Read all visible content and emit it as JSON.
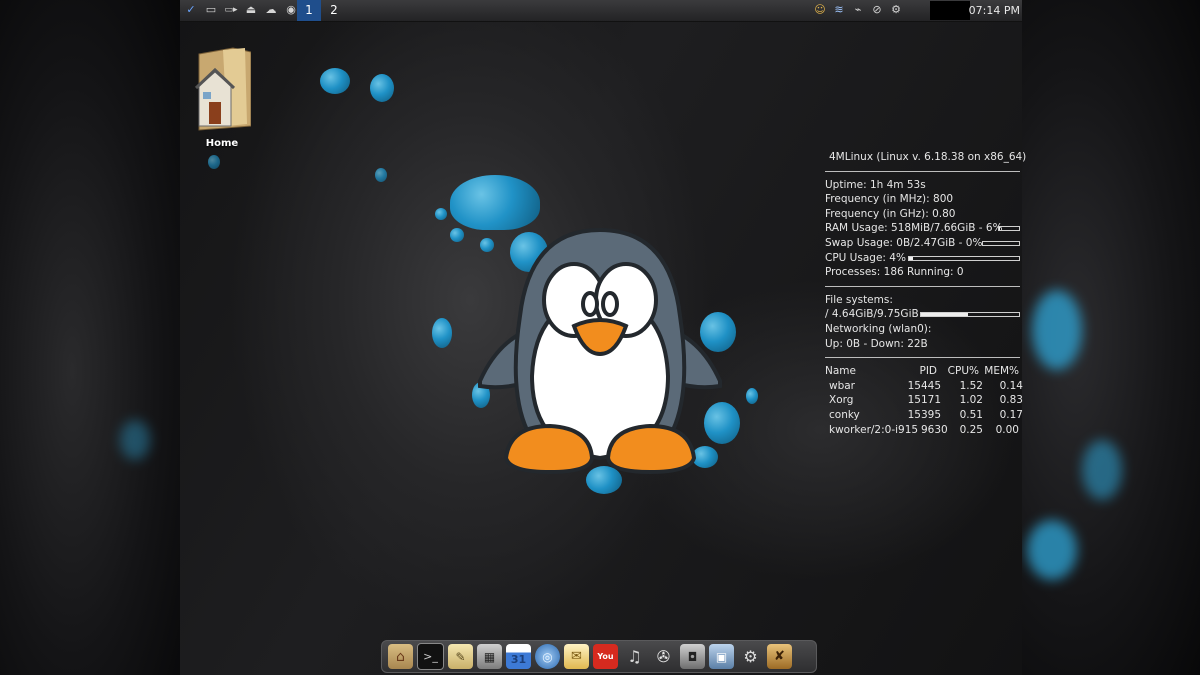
{
  "topbar": {
    "left_icons": [
      "menu-icon",
      "drive-icon",
      "battery-icon",
      "eject-icon",
      "network-icon",
      "disc-icon"
    ],
    "workspaces": [
      "1",
      "2"
    ],
    "active_workspace": "1",
    "right_icons": [
      "user-icon",
      "wifi-icon",
      "usb-icon",
      "paperclip-icon",
      "settings-icon"
    ],
    "clock": "07:14 PM"
  },
  "desktop_icons": [
    {
      "label": "Home",
      "icon": "home-folder-icon"
    }
  ],
  "conky": {
    "title": "4MLinux (Linux v. 6.18.38 on x86_64)",
    "uptime": "Uptime: 1h 4m 53s",
    "freq_mhz": "Frequency (in MHz): 800",
    "freq_ghz": "Frequency (in GHz): 0.80",
    "ram": {
      "text": "RAM Usage: 518MiB/7.66GiB - 6%",
      "percent": 6
    },
    "swap": {
      "text": "Swap Usage: 0B/2.47GiB - 0%",
      "percent": 0
    },
    "cpu": {
      "text": "CPU Usage: 4%",
      "percent": 4
    },
    "processes": "Processes: 186  Running: 0",
    "filesystems_label": "File systems:",
    "fs_root": {
      "text": " /  4.64GiB/9.75GiB",
      "percent": 48
    },
    "networking_label": "Networking (wlan0):",
    "net": "Up: 0B  - Down: 22B",
    "proc_headers": [
      "Name",
      "PID",
      "CPU%",
      "MEM%"
    ],
    "procs": [
      [
        "wbar",
        "15445",
        "1.52",
        "0.14"
      ],
      [
        "Xorg",
        "15171",
        "1.02",
        "0.83"
      ],
      [
        "conky",
        "15395",
        "0.51",
        "0.17"
      ],
      [
        "kworker/2:0-i915",
        "9630",
        "0.25",
        "0.00"
      ]
    ]
  },
  "dock": {
    "items": [
      "home-folder-icon",
      "terminal-icon",
      "text-editor-icon",
      "calculator-icon",
      "calendar-icon",
      "web-browser-icon",
      "mail-icon",
      "youtube-icon",
      "audio-player-icon",
      "video-player-icon",
      "camera-icon",
      "screenshot-icon",
      "system-settings-icon",
      "tools-icon"
    ],
    "calendar_day": "31",
    "youtube_label": "You"
  },
  "colors": {
    "accent_drop": "#1f9bd4",
    "workspace_active": "#1f4e8c",
    "penguin_orange": "#f28d1e",
    "penguin_body": "#5b6a78"
  }
}
